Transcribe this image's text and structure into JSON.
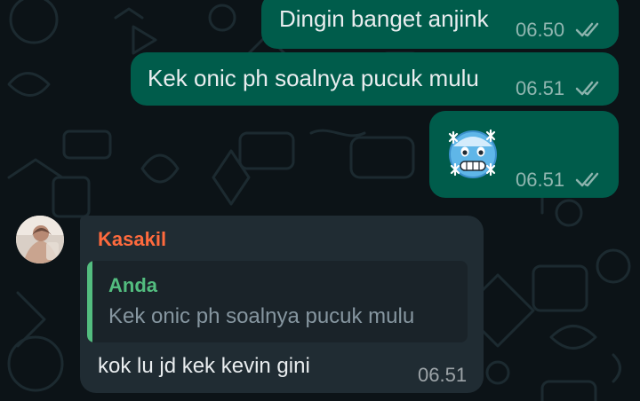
{
  "colors": {
    "background": "#0c1317",
    "outgoing_bubble": "#005c4b",
    "incoming_bubble": "#202c33",
    "sender_name": "#ff6a3d",
    "quote_accent": "#53bd7f"
  },
  "messages": [
    {
      "direction": "outgoing",
      "text": "Dingin banget anjink",
      "time": "06.50",
      "status_icon": "double-check-icon"
    },
    {
      "direction": "outgoing",
      "text": "Kek onic ph soalnya pucuk mulu",
      "time": "06.51",
      "status_icon": "double-check-icon"
    },
    {
      "direction": "outgoing",
      "emoji": "🥶",
      "emoji_name": "cold-face-emoji",
      "time": "06.51",
      "status_icon": "double-check-icon"
    },
    {
      "direction": "incoming",
      "sender": "Kasakil",
      "avatar_icon": "avatar",
      "reply_to": {
        "author": "Anda",
        "text": "Kek onic ph soalnya pucuk mulu"
      },
      "text": "kok lu jd kek kevin gini",
      "time": "06.51"
    }
  ]
}
